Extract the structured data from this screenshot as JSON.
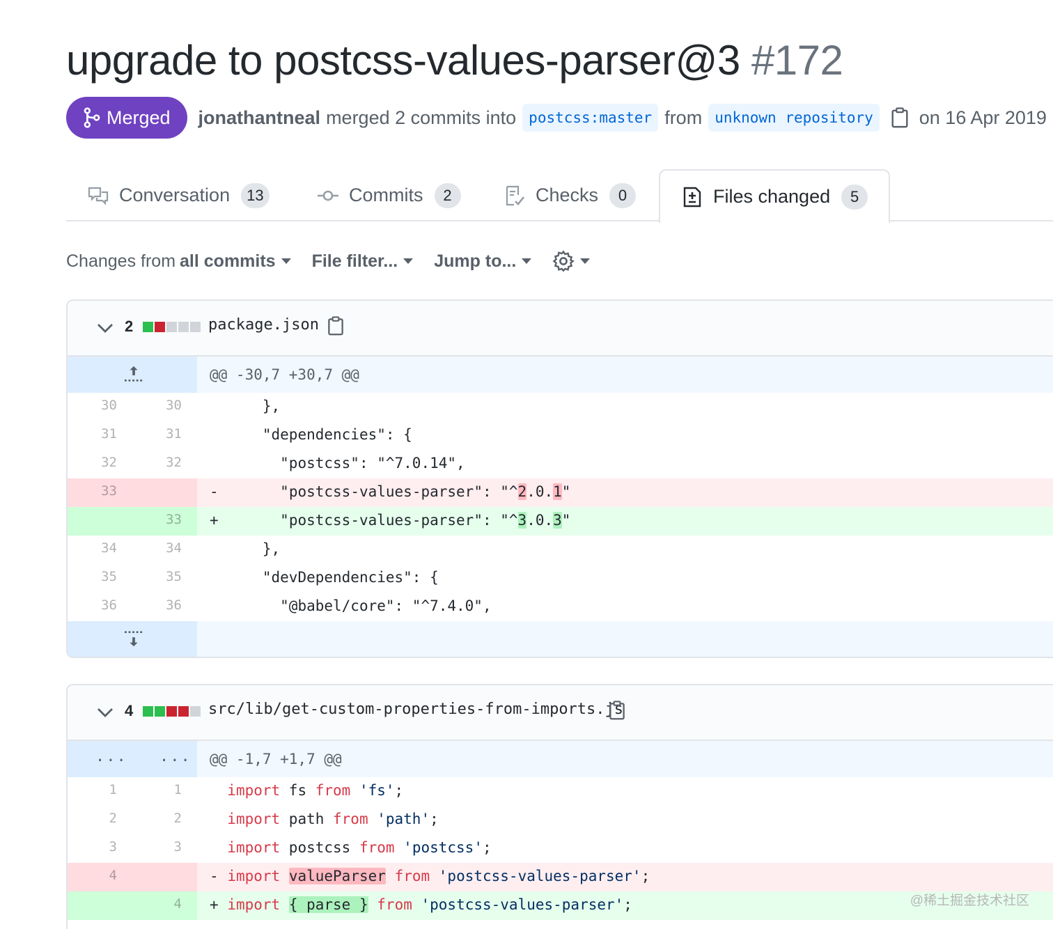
{
  "pr": {
    "title": "upgrade to postcss-values-parser@3",
    "number": "#172",
    "state": "Merged",
    "author": "jonathantneal",
    "merged_text": "merged 2 commits into",
    "base_branch": "postcss:master",
    "from_text": "from",
    "head_branch": "unknown repository",
    "date": "on 16 Apr 2019"
  },
  "tabs": [
    {
      "label": "Conversation",
      "count": "13",
      "icon": "comment-discussion-icon"
    },
    {
      "label": "Commits",
      "count": "2",
      "icon": "git-commit-icon"
    },
    {
      "label": "Checks",
      "count": "0",
      "icon": "checklist-icon"
    },
    {
      "label": "Files changed",
      "count": "5",
      "icon": "file-diff-icon",
      "selected": true
    }
  ],
  "toolbar": {
    "changes_prefix": "Changes from ",
    "changes_value": "all commits",
    "file_filter": "File filter...",
    "jump_to": "Jump to...",
    "settings_icon": "gear-icon"
  },
  "files": [
    {
      "changes": "2",
      "diffstat": [
        "add",
        "del",
        "neu",
        "neu",
        "neu"
      ],
      "name": "package.json",
      "hunk": "@@ -30,7 +30,7 @@",
      "lines": [
        {
          "type": "ctx",
          "old": "30",
          "new": "30",
          "sign": " ",
          "text": "    },"
        },
        {
          "type": "ctx",
          "old": "31",
          "new": "31",
          "sign": " ",
          "text": "    \"dependencies\": {"
        },
        {
          "type": "ctx",
          "old": "32",
          "new": "32",
          "sign": " ",
          "text": "      \"postcss\": \"^7.0.14\","
        },
        {
          "type": "del",
          "old": "33",
          "new": "",
          "sign": "-",
          "pre": "      \"postcss-values-parser\": \"^",
          "h1": "2",
          "mid": ".0.",
          "h2": "1",
          "post": "\""
        },
        {
          "type": "add",
          "old": "",
          "new": "33",
          "sign": "+",
          "pre": "      \"postcss-values-parser\": \"^",
          "h1": "3",
          "mid": ".0.",
          "h2": "3",
          "post": "\""
        },
        {
          "type": "ctx",
          "old": "34",
          "new": "34",
          "sign": " ",
          "text": "    },"
        },
        {
          "type": "ctx",
          "old": "35",
          "new": "35",
          "sign": " ",
          "text": "    \"devDependencies\": {"
        },
        {
          "type": "ctx",
          "old": "36",
          "new": "36",
          "sign": " ",
          "text": "      \"@babel/core\": \"^7.4.0\","
        }
      ]
    },
    {
      "changes": "4",
      "diffstat": [
        "add",
        "add",
        "del",
        "del",
        "neu"
      ],
      "name": "src/lib/get-custom-properties-from-imports.js",
      "hunk": "@@ -1,7 +1,7 @@",
      "hunk_dots": "...",
      "lines": [
        {
          "old": "1",
          "new": "1",
          "kw1": "import",
          "id": " fs ",
          "kw2": "from",
          "str": " 'fs'",
          "end": ";"
        },
        {
          "old": "2",
          "new": "2",
          "kw1": "import",
          "id": " path ",
          "kw2": "from",
          "str": " 'path'",
          "end": ";"
        },
        {
          "old": "3",
          "new": "3",
          "kw1": "import",
          "id": " postcss ",
          "kw2": "from",
          "str": " 'postcss'",
          "end": ";"
        },
        {
          "old": "4",
          "new": "",
          "sign": "-",
          "kw1": "import",
          "hl": "valueParser",
          "kw2": "from",
          "str": " 'postcss-values-parser'",
          "end": ";"
        },
        {
          "old": "",
          "new": "4",
          "sign": "+",
          "kw1": "import",
          "hl": "{ parse }",
          "kw2": "from",
          "str": " 'postcss-values-parser'",
          "end": ";"
        }
      ]
    }
  ],
  "watermark": "@稀土掘金技术社区"
}
